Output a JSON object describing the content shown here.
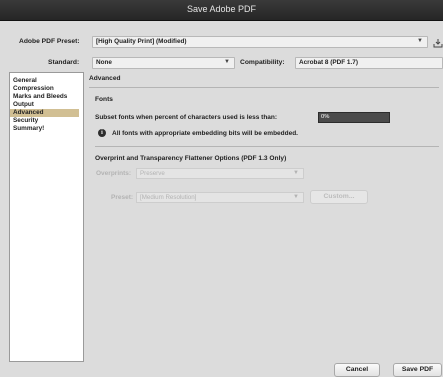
{
  "window": {
    "title": "Save Adobe PDF"
  },
  "preset": {
    "label": "Adobe PDF Preset:",
    "value": "[High Quality Print] (Modified)"
  },
  "standard": {
    "label": "Standard:",
    "value": "None"
  },
  "compatibility": {
    "label": "Compatibility:",
    "value": "Acrobat 8 (PDF 1.7)"
  },
  "sidebar": {
    "items": [
      {
        "label": "General"
      },
      {
        "label": "Compression"
      },
      {
        "label": "Marks and Bleeds"
      },
      {
        "label": "Output"
      },
      {
        "label": "Advanced"
      },
      {
        "label": "Security"
      },
      {
        "label": "Summary!"
      }
    ],
    "active_index": 4
  },
  "advanced": {
    "title": "Advanced",
    "fonts": {
      "heading": "Fonts",
      "subset_label": "Subset fonts when percent of characters used is less than:",
      "subset_value": "0%",
      "info_text": "All fonts with appropriate embedding bits will be embedded."
    },
    "overprint": {
      "heading": "Overprint and Transparency Flattener Options (PDF 1.3 Only)",
      "overprints_label": "Overprints:",
      "overprints_value": "Preserve",
      "preset_label": "Preset:",
      "preset_value": "[Medium Resolution]",
      "custom_button": "Custom..."
    }
  },
  "buttons": {
    "cancel": "Cancel",
    "save": "Save PDF"
  },
  "colors": {
    "active_item": "#d1bf93",
    "titlebar": "#2f2f2f"
  }
}
